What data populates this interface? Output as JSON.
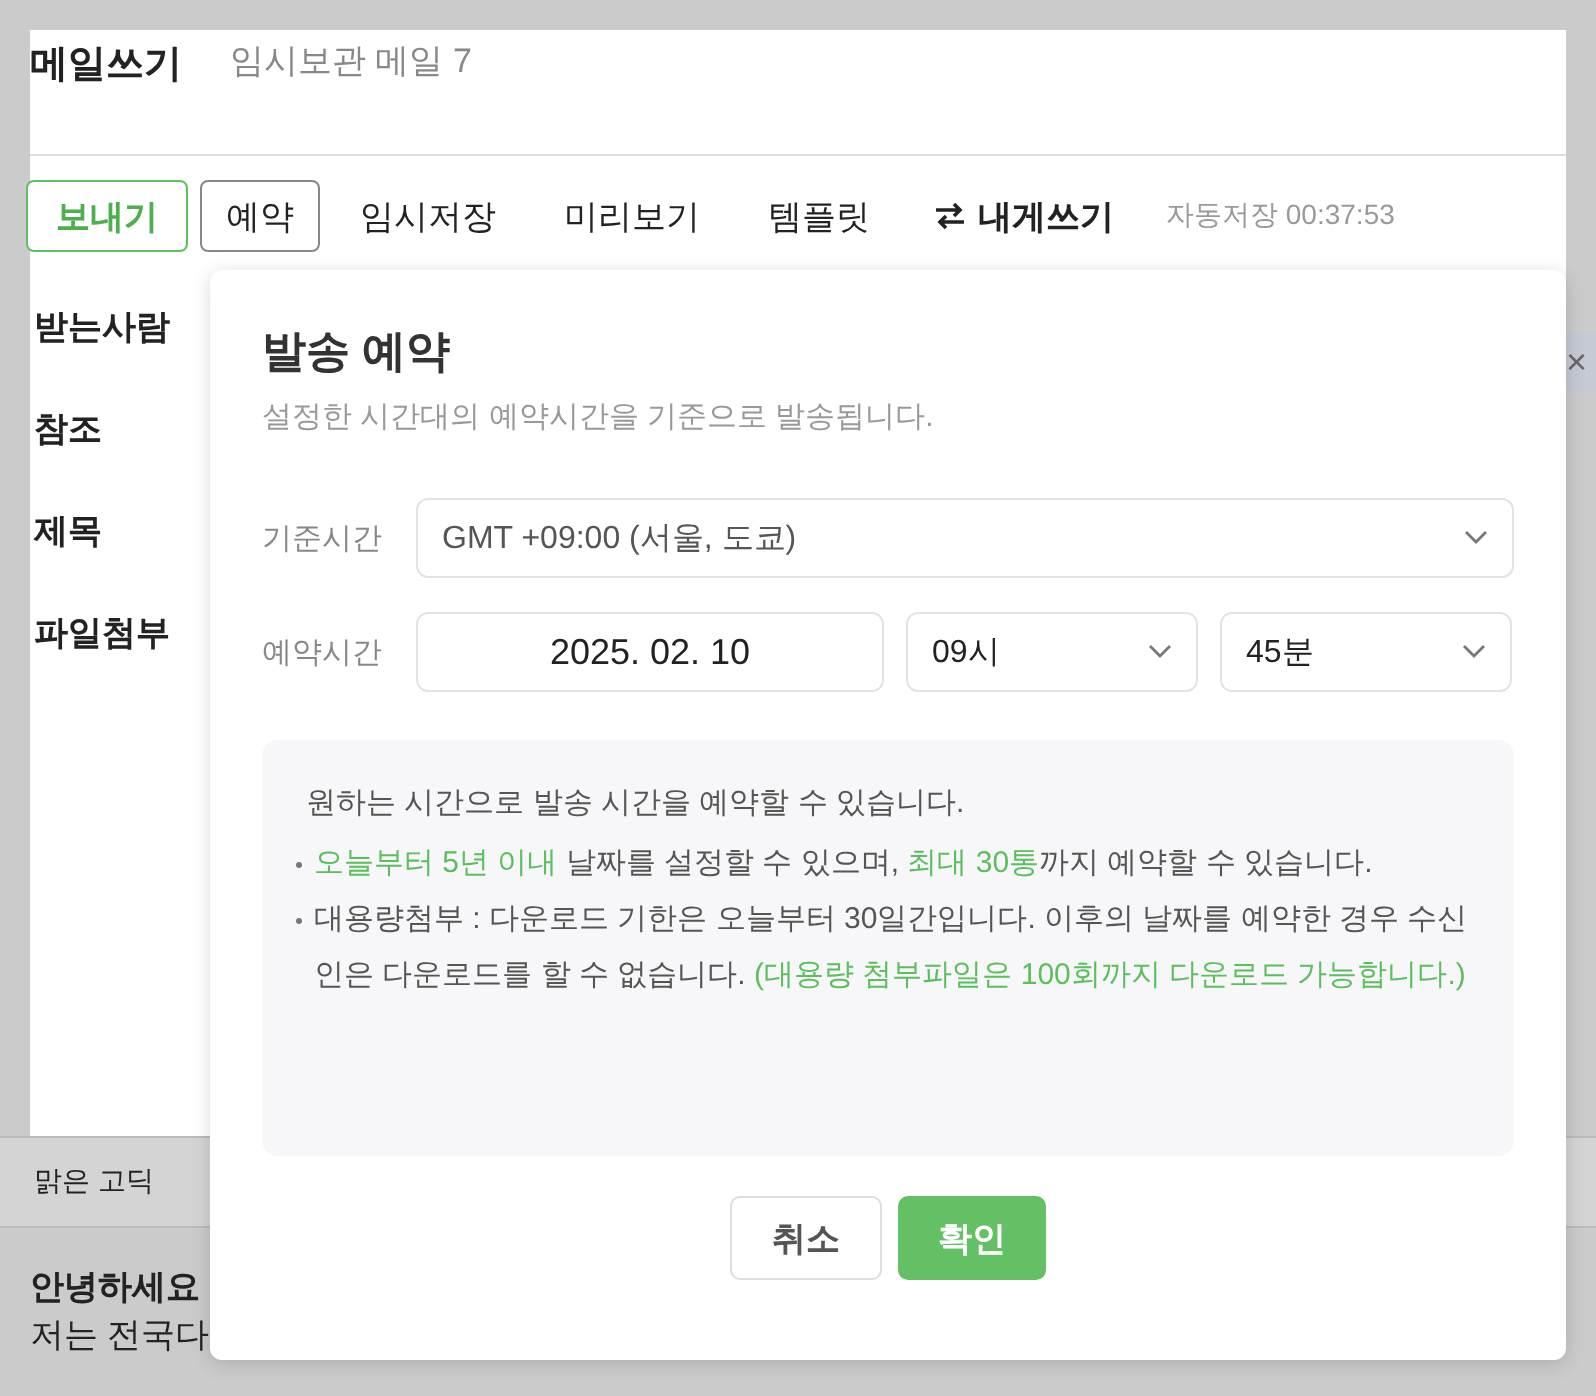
{
  "header": {
    "title": "메일쓰기",
    "draft_label": "임시보관 메일 7"
  },
  "toolbar": {
    "buttons": [
      {
        "label": "보내기",
        "kind": "primary"
      },
      {
        "label": "예약",
        "kind": "outlined"
      },
      {
        "label": "임시저장",
        "kind": "plain"
      },
      {
        "label": "미리보기",
        "kind": "plain"
      },
      {
        "label": "템플릿",
        "kind": "plain"
      },
      {
        "label": "내게쓰기",
        "kind": "swap"
      }
    ],
    "autosave": {
      "label": "자동저장",
      "time": "00:37:53"
    }
  },
  "fields": [
    {
      "label": "받는사람",
      "edge": "×"
    },
    {
      "label": "참조"
    },
    {
      "label": "제목"
    },
    {
      "label": "파일첨부"
    }
  ],
  "editor": {
    "font": "맑은 고딕",
    "lines": [
      {
        "text": "안녕하세요",
        "bold": true
      },
      {
        "text": "저는 전국다",
        "bold": false
      }
    ]
  },
  "modal": {
    "title": "발송 예약",
    "description": "설정한 시간대의 예약시간을 기준으로 발송됩니다.",
    "timezone": {
      "label": "기준시간",
      "value": "GMT +09:00 (서울, 도쿄)"
    },
    "schedule": {
      "label": "예약시간",
      "date": "2025. 02. 10",
      "hour": "09시",
      "minute": "45분"
    },
    "info": {
      "intro": "원하는 시간으로 발송 시간을 예약할 수 있습니다.",
      "bullets": [
        [
          {
            "text": "오늘부터 5년 이내",
            "highlight": true
          },
          {
            "text": " 날짜를 설정할 수 있으며, ",
            "highlight": false
          },
          {
            "text": "최대 30통",
            "highlight": true
          },
          {
            "text": "까지 예약할 수 있습니다.",
            "highlight": false
          }
        ],
        [
          {
            "text": "대용량첨부 : 다운로드 기한은 오늘부터 30일간입니다. 이후의 날짜를 예약한 경우 수신인은 다운로드를 할 수 없습니다. ",
            "highlight": false
          },
          {
            "text": "(대용량 첨부파일은 100회까지 다운로드 가능합니다.)",
            "highlight": true
          }
        ]
      ]
    },
    "cancel": "취소",
    "confirm": "확인"
  }
}
